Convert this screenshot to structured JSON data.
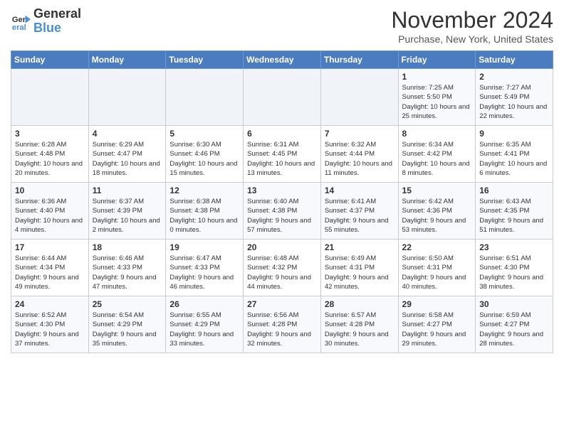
{
  "logo": {
    "line1": "General",
    "line2": "Blue"
  },
  "title": "November 2024",
  "location": "Purchase, New York, United States",
  "days_of_week": [
    "Sunday",
    "Monday",
    "Tuesday",
    "Wednesday",
    "Thursday",
    "Friday",
    "Saturday"
  ],
  "weeks": [
    [
      {
        "day": "",
        "info": ""
      },
      {
        "day": "",
        "info": ""
      },
      {
        "day": "",
        "info": ""
      },
      {
        "day": "",
        "info": ""
      },
      {
        "day": "",
        "info": ""
      },
      {
        "day": "1",
        "info": "Sunrise: 7:25 AM\nSunset: 5:50 PM\nDaylight: 10 hours and 25 minutes."
      },
      {
        "day": "2",
        "info": "Sunrise: 7:27 AM\nSunset: 5:49 PM\nDaylight: 10 hours and 22 minutes."
      }
    ],
    [
      {
        "day": "3",
        "info": "Sunrise: 6:28 AM\nSunset: 4:48 PM\nDaylight: 10 hours and 20 minutes."
      },
      {
        "day": "4",
        "info": "Sunrise: 6:29 AM\nSunset: 4:47 PM\nDaylight: 10 hours and 18 minutes."
      },
      {
        "day": "5",
        "info": "Sunrise: 6:30 AM\nSunset: 4:46 PM\nDaylight: 10 hours and 15 minutes."
      },
      {
        "day": "6",
        "info": "Sunrise: 6:31 AM\nSunset: 4:45 PM\nDaylight: 10 hours and 13 minutes."
      },
      {
        "day": "7",
        "info": "Sunrise: 6:32 AM\nSunset: 4:44 PM\nDaylight: 10 hours and 11 minutes."
      },
      {
        "day": "8",
        "info": "Sunrise: 6:34 AM\nSunset: 4:42 PM\nDaylight: 10 hours and 8 minutes."
      },
      {
        "day": "9",
        "info": "Sunrise: 6:35 AM\nSunset: 4:41 PM\nDaylight: 10 hours and 6 minutes."
      }
    ],
    [
      {
        "day": "10",
        "info": "Sunrise: 6:36 AM\nSunset: 4:40 PM\nDaylight: 10 hours and 4 minutes."
      },
      {
        "day": "11",
        "info": "Sunrise: 6:37 AM\nSunset: 4:39 PM\nDaylight: 10 hours and 2 minutes."
      },
      {
        "day": "12",
        "info": "Sunrise: 6:38 AM\nSunset: 4:38 PM\nDaylight: 10 hours and 0 minutes."
      },
      {
        "day": "13",
        "info": "Sunrise: 6:40 AM\nSunset: 4:38 PM\nDaylight: 9 hours and 57 minutes."
      },
      {
        "day": "14",
        "info": "Sunrise: 6:41 AM\nSunset: 4:37 PM\nDaylight: 9 hours and 55 minutes."
      },
      {
        "day": "15",
        "info": "Sunrise: 6:42 AM\nSunset: 4:36 PM\nDaylight: 9 hours and 53 minutes."
      },
      {
        "day": "16",
        "info": "Sunrise: 6:43 AM\nSunset: 4:35 PM\nDaylight: 9 hours and 51 minutes."
      }
    ],
    [
      {
        "day": "17",
        "info": "Sunrise: 6:44 AM\nSunset: 4:34 PM\nDaylight: 9 hours and 49 minutes."
      },
      {
        "day": "18",
        "info": "Sunrise: 6:46 AM\nSunset: 4:33 PM\nDaylight: 9 hours and 47 minutes."
      },
      {
        "day": "19",
        "info": "Sunrise: 6:47 AM\nSunset: 4:33 PM\nDaylight: 9 hours and 46 minutes."
      },
      {
        "day": "20",
        "info": "Sunrise: 6:48 AM\nSunset: 4:32 PM\nDaylight: 9 hours and 44 minutes."
      },
      {
        "day": "21",
        "info": "Sunrise: 6:49 AM\nSunset: 4:31 PM\nDaylight: 9 hours and 42 minutes."
      },
      {
        "day": "22",
        "info": "Sunrise: 6:50 AM\nSunset: 4:31 PM\nDaylight: 9 hours and 40 minutes."
      },
      {
        "day": "23",
        "info": "Sunrise: 6:51 AM\nSunset: 4:30 PM\nDaylight: 9 hours and 38 minutes."
      }
    ],
    [
      {
        "day": "24",
        "info": "Sunrise: 6:52 AM\nSunset: 4:30 PM\nDaylight: 9 hours and 37 minutes."
      },
      {
        "day": "25",
        "info": "Sunrise: 6:54 AM\nSunset: 4:29 PM\nDaylight: 9 hours and 35 minutes."
      },
      {
        "day": "26",
        "info": "Sunrise: 6:55 AM\nSunset: 4:29 PM\nDaylight: 9 hours and 33 minutes."
      },
      {
        "day": "27",
        "info": "Sunrise: 6:56 AM\nSunset: 4:28 PM\nDaylight: 9 hours and 32 minutes."
      },
      {
        "day": "28",
        "info": "Sunrise: 6:57 AM\nSunset: 4:28 PM\nDaylight: 9 hours and 30 minutes."
      },
      {
        "day": "29",
        "info": "Sunrise: 6:58 AM\nSunset: 4:27 PM\nDaylight: 9 hours and 29 minutes."
      },
      {
        "day": "30",
        "info": "Sunrise: 6:59 AM\nSunset: 4:27 PM\nDaylight: 9 hours and 28 minutes."
      }
    ]
  ]
}
